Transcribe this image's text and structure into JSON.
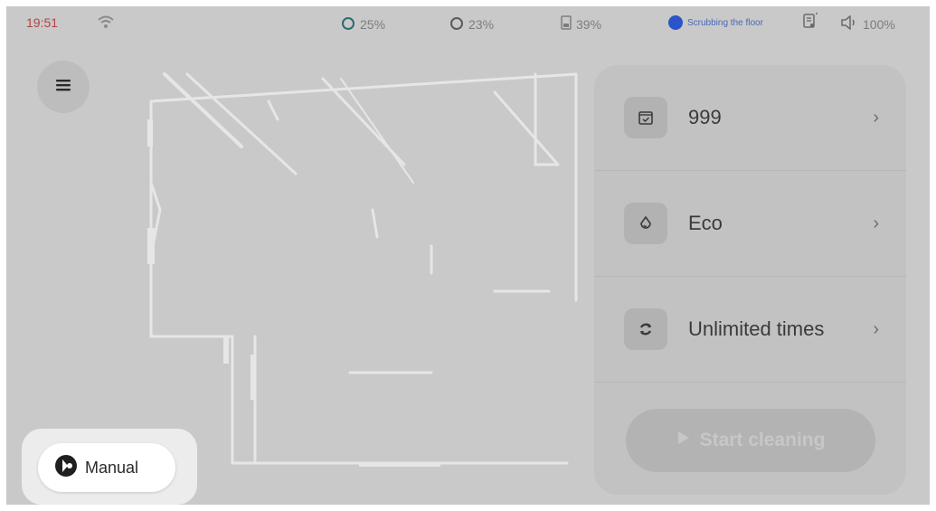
{
  "status_bar": {
    "time": "19:51",
    "wifi_icon": "wifi-icon",
    "water_clean_level": "25%",
    "water_dirty_level": "23%",
    "battery_device_level": "39%",
    "status_text": "Scrubbing the floor",
    "volume_level": "100%"
  },
  "menu": {
    "icon": "hamburger-menu-icon"
  },
  "panel": {
    "rows": [
      {
        "icon": "calendar-check-icon",
        "label": "999"
      },
      {
        "icon": "water-drop-icon",
        "label": "Eco"
      },
      {
        "icon": "cycle-icon",
        "label": "Unlimited times"
      }
    ],
    "start_label": "Start cleaning"
  },
  "manual": {
    "label": "Manual",
    "icon": "joystick-icon"
  },
  "colors": {
    "overlay": "#c9c9c9",
    "status_blue": "#2b54c9",
    "time_red": "#b04545"
  }
}
